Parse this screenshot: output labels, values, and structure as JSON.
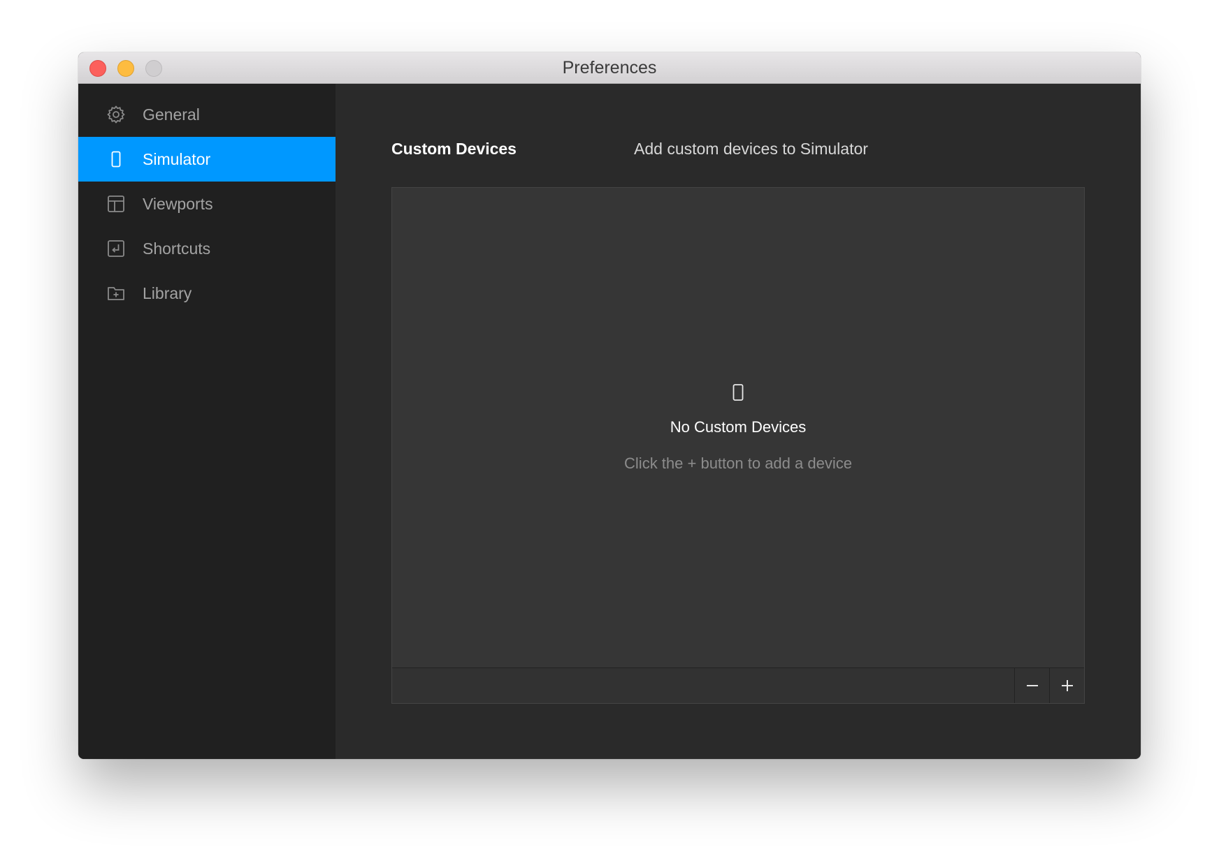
{
  "window": {
    "title": "Preferences"
  },
  "sidebar": {
    "items": [
      {
        "label": "General",
        "icon": "gear-icon",
        "active": false
      },
      {
        "label": "Simulator",
        "icon": "phone-icon",
        "active": true
      },
      {
        "label": "Viewports",
        "icon": "layout-icon",
        "active": false
      },
      {
        "label": "Shortcuts",
        "icon": "keyboard-return-icon",
        "active": false
      },
      {
        "label": "Library",
        "icon": "folder-plus-icon",
        "active": false
      }
    ]
  },
  "main": {
    "section_title": "Custom Devices",
    "section_description": "Add custom devices to Simulator",
    "empty_state": {
      "icon": "phone-icon",
      "title": "No Custom Devices",
      "hint": "Click the + button to add a device"
    },
    "footer_buttons": {
      "remove": "minus-icon",
      "add": "plus-icon"
    }
  },
  "colors": {
    "accent": "#0098ff",
    "sidebar_bg": "#202020",
    "content_bg": "#2a2a2a",
    "panel_bg": "#363636"
  }
}
